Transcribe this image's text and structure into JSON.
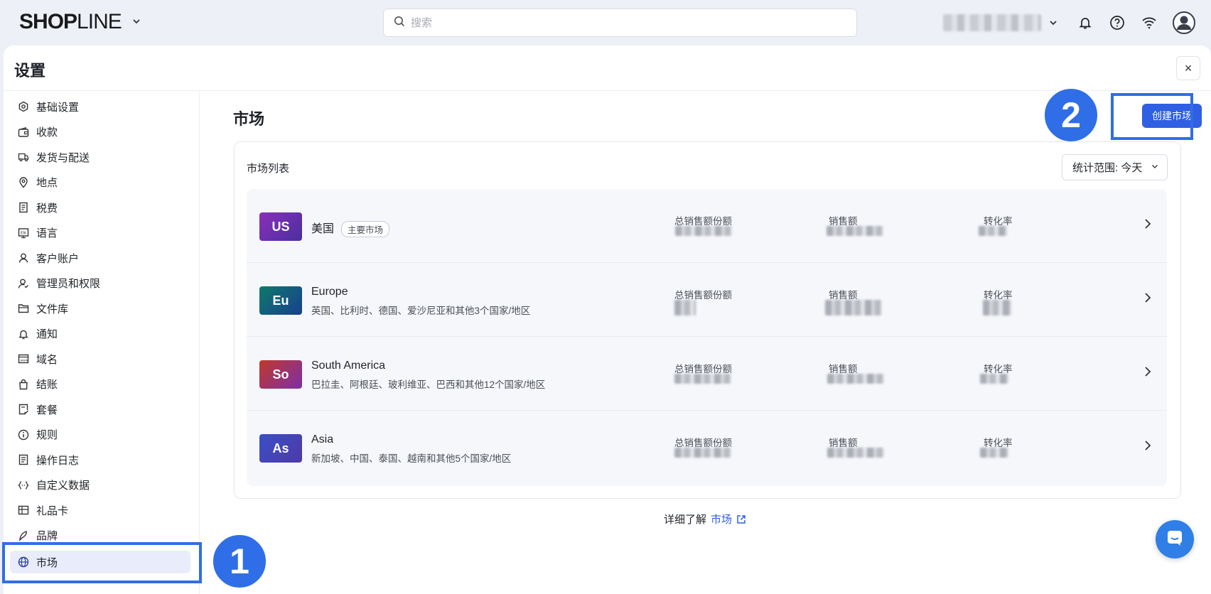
{
  "topbar": {
    "logo_bold": "SH",
    "logo_o": "O",
    "logo_p": "P",
    "logo_light": "LINE",
    "search_placeholder": "搜索"
  },
  "settings": {
    "title": "设置",
    "close_label": "×"
  },
  "sidebar": {
    "items": [
      {
        "label": "基础设置",
        "icon": "gear-hex-icon"
      },
      {
        "label": "收款",
        "icon": "wallet-icon"
      },
      {
        "label": "发货与配送",
        "icon": "truck-icon"
      },
      {
        "label": "地点",
        "icon": "location-pin-icon"
      },
      {
        "label": "税费",
        "icon": "receipt-icon"
      },
      {
        "label": "语言",
        "icon": "language-icon"
      },
      {
        "label": "客户账户",
        "icon": "user-icon"
      },
      {
        "label": "管理员和权限",
        "icon": "admin-user-icon"
      },
      {
        "label": "文件库",
        "icon": "folder-icon"
      },
      {
        "label": "通知",
        "icon": "bell-icon"
      },
      {
        "label": "域名",
        "icon": "domain-icon"
      },
      {
        "label": "结账",
        "icon": "shopping-bag-icon"
      },
      {
        "label": "套餐",
        "icon": "plan-icon"
      },
      {
        "label": "规则",
        "icon": "info-icon"
      },
      {
        "label": "操作日志",
        "icon": "log-icon"
      },
      {
        "label": "自定义数据",
        "icon": "code-icon"
      },
      {
        "label": "礼品卡",
        "icon": "gift-card-icon"
      },
      {
        "label": "品牌",
        "icon": "brand-icon"
      },
      {
        "label": "市场",
        "icon": "globe-icon"
      }
    ]
  },
  "annotations": {
    "step1": "1",
    "step2": "2"
  },
  "content": {
    "title": "市场",
    "create_button": "创建市场",
    "list_title": "市场列表",
    "range_label": "统计范围: 今天",
    "learn_more_prefix": "详细了解",
    "learn_more_link": "市场"
  },
  "markets": [
    {
      "code": "US",
      "name": "美国",
      "tag": "主要市场",
      "sub": "",
      "color_from": "#8a2fb8",
      "color_to": "#4a2fa0"
    },
    {
      "code": "Eu",
      "name": "Europe",
      "tag": "",
      "sub": "英国、比利时、德国、爱沙尼亚和其他3个国家/地区",
      "color_from": "#0d7a6a",
      "color_to": "#1a3f8f"
    },
    {
      "code": "So",
      "name": "South America",
      "tag": "",
      "sub": "巴拉圭、阿根廷、玻利维亚、巴西和其他12个国家/地区",
      "color_from": "#c0392b",
      "color_to": "#7d2fa8"
    },
    {
      "code": "As",
      "name": "Asia",
      "tag": "",
      "sub": "新加坡、中国、泰国、越南和其他5个国家/地区",
      "color_from": "#3a4fc8",
      "color_to": "#4e3aa8"
    }
  ],
  "stat_labels": {
    "share": "总销售额份额",
    "sales": "销售额",
    "conversion": "转化率"
  }
}
